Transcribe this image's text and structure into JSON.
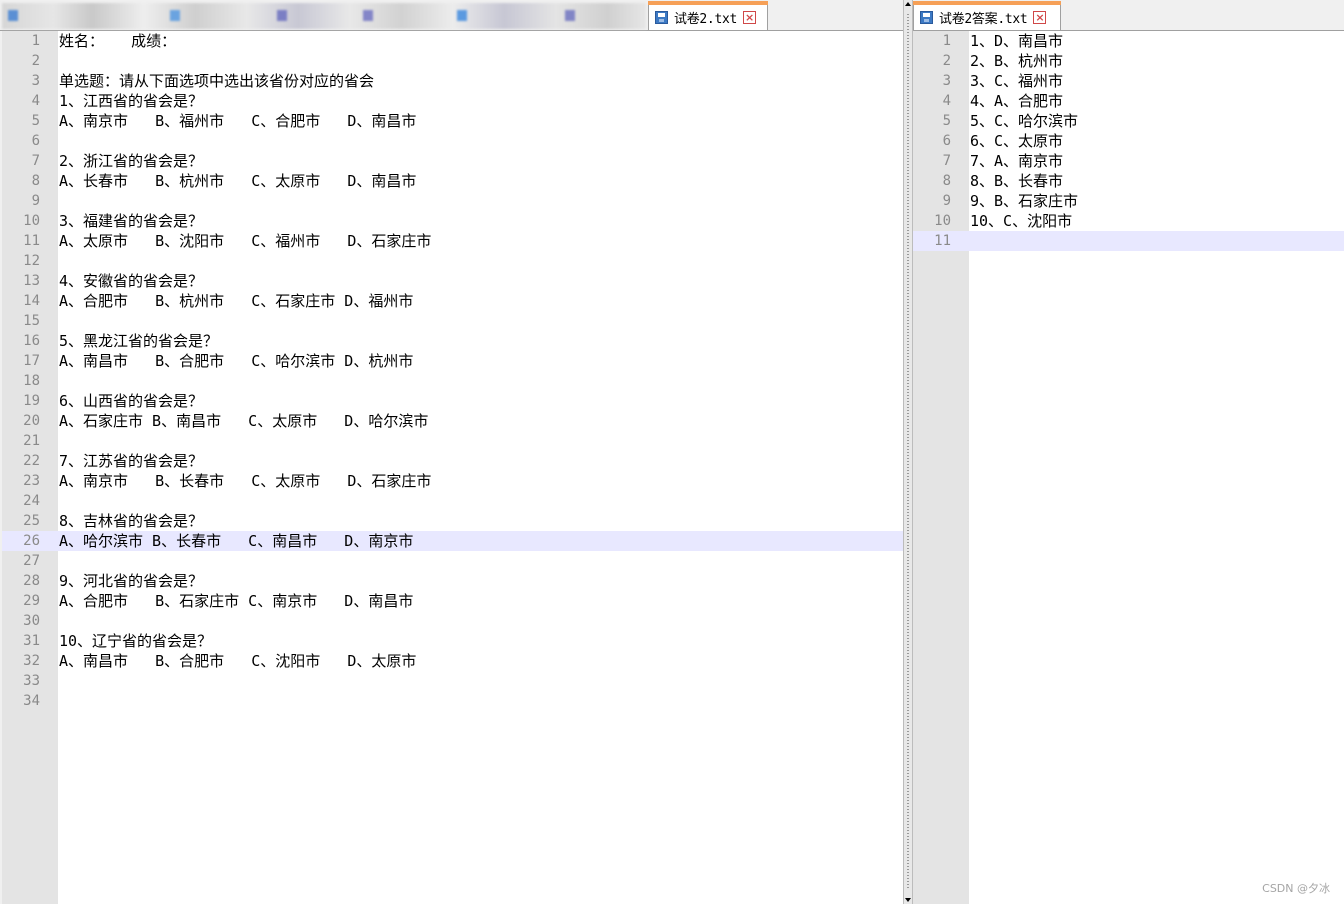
{
  "left_pane": {
    "tab": {
      "title": "试卷2.txt"
    },
    "lines": [
      {
        "n": "1",
        "text": "姓名：   成绩："
      },
      {
        "n": "2",
        "text": ""
      },
      {
        "n": "3",
        "text": "单选题：请从下面选项中选出该省份对应的省会"
      },
      {
        "n": "4",
        "text": "1、江西省的省会是？"
      },
      {
        "n": "5",
        "text": "A、南京市   B、福州市   C、合肥市   D、南昌市"
      },
      {
        "n": "6",
        "text": ""
      },
      {
        "n": "7",
        "text": "2、浙江省的省会是？"
      },
      {
        "n": "8",
        "text": "A、长春市   B、杭州市   C、太原市   D、南昌市"
      },
      {
        "n": "9",
        "text": ""
      },
      {
        "n": "10",
        "text": "3、福建省的省会是？"
      },
      {
        "n": "11",
        "text": "A、太原市   B、沈阳市   C、福州市   D、石家庄市"
      },
      {
        "n": "12",
        "text": ""
      },
      {
        "n": "13",
        "text": "4、安徽省的省会是？"
      },
      {
        "n": "14",
        "text": "A、合肥市   B、杭州市   C、石家庄市 D、福州市"
      },
      {
        "n": "15",
        "text": ""
      },
      {
        "n": "16",
        "text": "5、黑龙江省的省会是？"
      },
      {
        "n": "17",
        "text": "A、南昌市   B、合肥市   C、哈尔滨市 D、杭州市"
      },
      {
        "n": "18",
        "text": ""
      },
      {
        "n": "19",
        "text": "6、山西省的省会是？"
      },
      {
        "n": "20",
        "text": "A、石家庄市 B、南昌市   C、太原市   D、哈尔滨市"
      },
      {
        "n": "21",
        "text": ""
      },
      {
        "n": "22",
        "text": "7、江苏省的省会是？"
      },
      {
        "n": "23",
        "text": "A、南京市   B、长春市   C、太原市   D、石家庄市"
      },
      {
        "n": "24",
        "text": ""
      },
      {
        "n": "25",
        "text": "8、吉林省的省会是？"
      },
      {
        "n": "26",
        "text": "A、哈尔滨市 B、长春市   C、南昌市   D、南京市",
        "current": true
      },
      {
        "n": "27",
        "text": ""
      },
      {
        "n": "28",
        "text": "9、河北省的省会是？"
      },
      {
        "n": "29",
        "text": "A、合肥市   B、石家庄市 C、南京市   D、南昌市"
      },
      {
        "n": "30",
        "text": ""
      },
      {
        "n": "31",
        "text": "10、辽宁省的省会是？"
      },
      {
        "n": "32",
        "text": "A、南昌市   B、合肥市   C、沈阳市   D、太原市"
      },
      {
        "n": "33",
        "text": ""
      },
      {
        "n": "34",
        "text": ""
      }
    ]
  },
  "right_pane": {
    "tab": {
      "title": "试卷2答案.txt"
    },
    "lines": [
      {
        "n": "1",
        "text": "1、D、南昌市"
      },
      {
        "n": "2",
        "text": "2、B、杭州市"
      },
      {
        "n": "3",
        "text": "3、C、福州市"
      },
      {
        "n": "4",
        "text": "4、A、合肥市"
      },
      {
        "n": "5",
        "text": "5、C、哈尔滨市"
      },
      {
        "n": "6",
        "text": "6、C、太原市"
      },
      {
        "n": "7",
        "text": "7、A、南京市"
      },
      {
        "n": "8",
        "text": "8、B、长春市"
      },
      {
        "n": "9",
        "text": "9、B、石家庄市"
      },
      {
        "n": "10",
        "text": "10、C、沈阳市"
      },
      {
        "n": "11",
        "text": "",
        "current": true
      }
    ]
  },
  "icons": {
    "tab_save": "save-icon",
    "tab_close": "close-icon"
  },
  "colors": {
    "active_tab_accent": "#f6a057",
    "current_line": "#e8e8ff",
    "gutter": "#e4e4e4"
  },
  "watermark": "CSDN @夕冰"
}
